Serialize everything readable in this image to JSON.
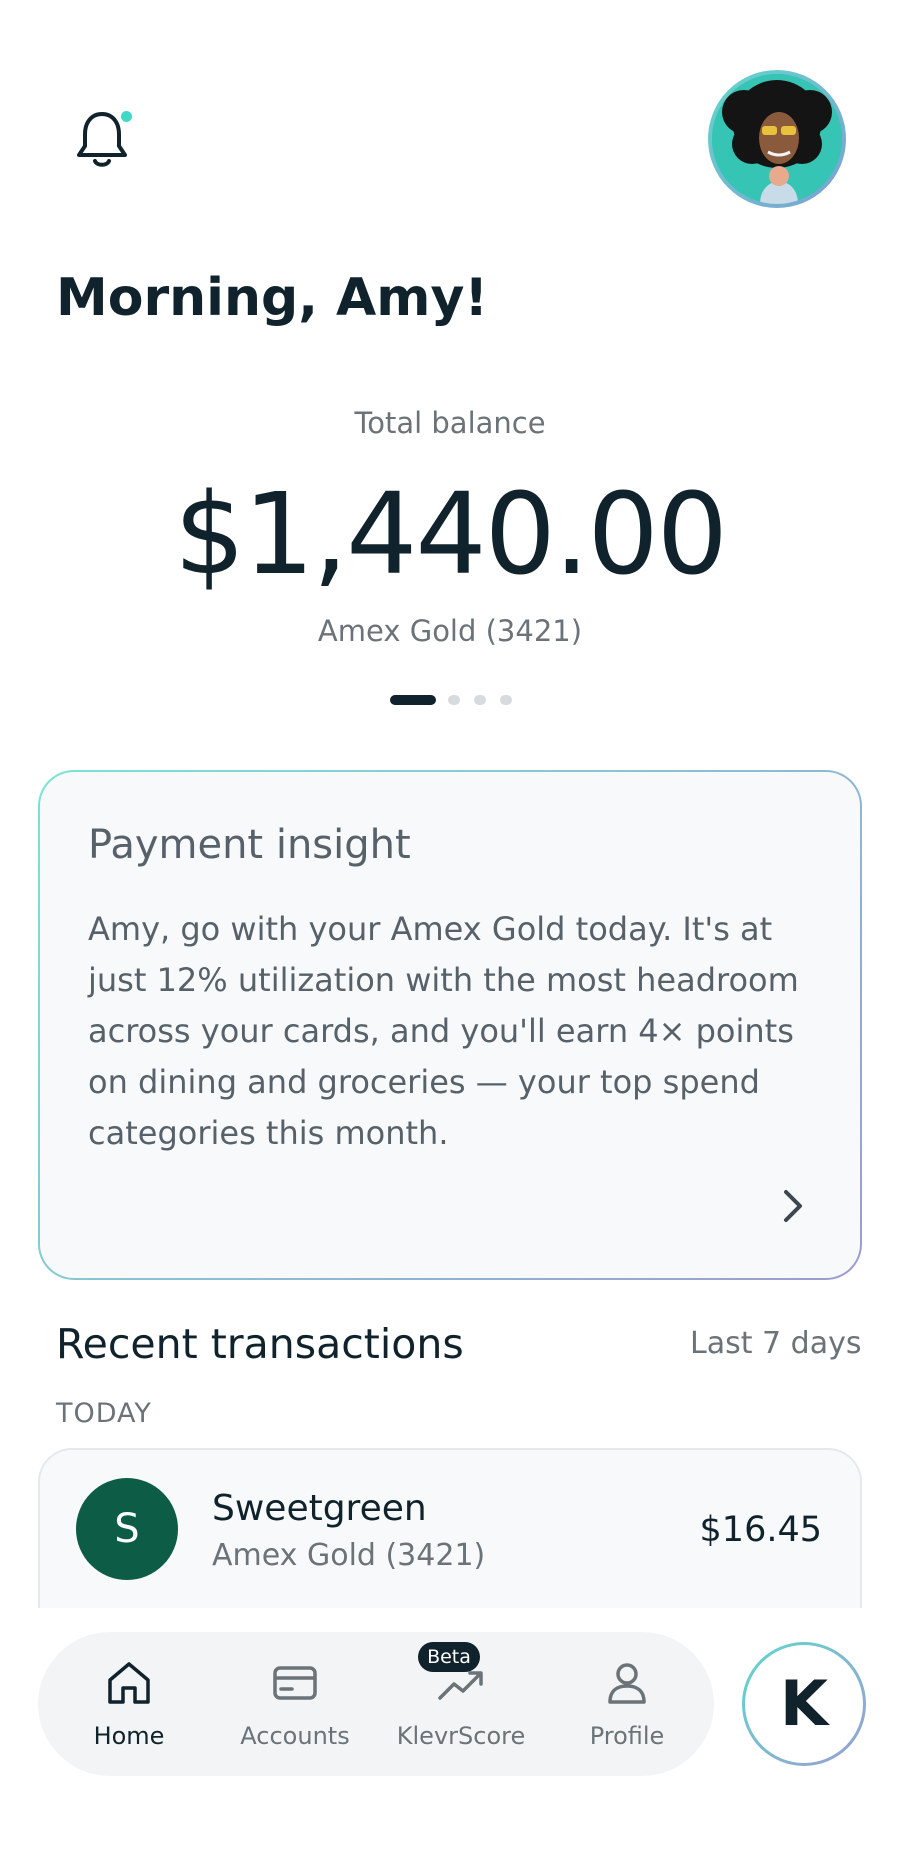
{
  "header": {
    "greeting": "Morning, Amy!"
  },
  "balance": {
    "label": "Total balance",
    "amount": "$1,440.00",
    "card": "Amex Gold (3421)",
    "page_index": 1,
    "page_count": 4
  },
  "insight": {
    "title": "Payment insight",
    "body": "Amy, go with your Amex Gold today. It's at just 12% utilization with the most headroom across your cards, and you'll earn 4× points on dining and groceries — your top spend categories this month."
  },
  "recent": {
    "title": "Recent transactions",
    "range": "Last 7 days",
    "groups": [
      {
        "label": "TODAY",
        "items": [
          {
            "initial": "S",
            "merchant": "Sweetgreen",
            "card": "Amex Gold (3421)",
            "amount": "$16.45"
          }
        ]
      }
    ]
  },
  "nav": {
    "items": [
      {
        "label": "Home",
        "icon": "home-icon",
        "active": true
      },
      {
        "label": "Accounts",
        "icon": "credit-card-icon"
      },
      {
        "label": "KlevrScore",
        "icon": "trending-up-icon",
        "badge": "Beta"
      },
      {
        "label": "Profile",
        "icon": "person-icon"
      }
    ],
    "assistant_label": "K"
  },
  "colors": {
    "primary": "#10222b",
    "accent_teal": "#3fd9c8",
    "merchant_avatar": "#0d5c45",
    "muted_text": "#6b7378"
  }
}
